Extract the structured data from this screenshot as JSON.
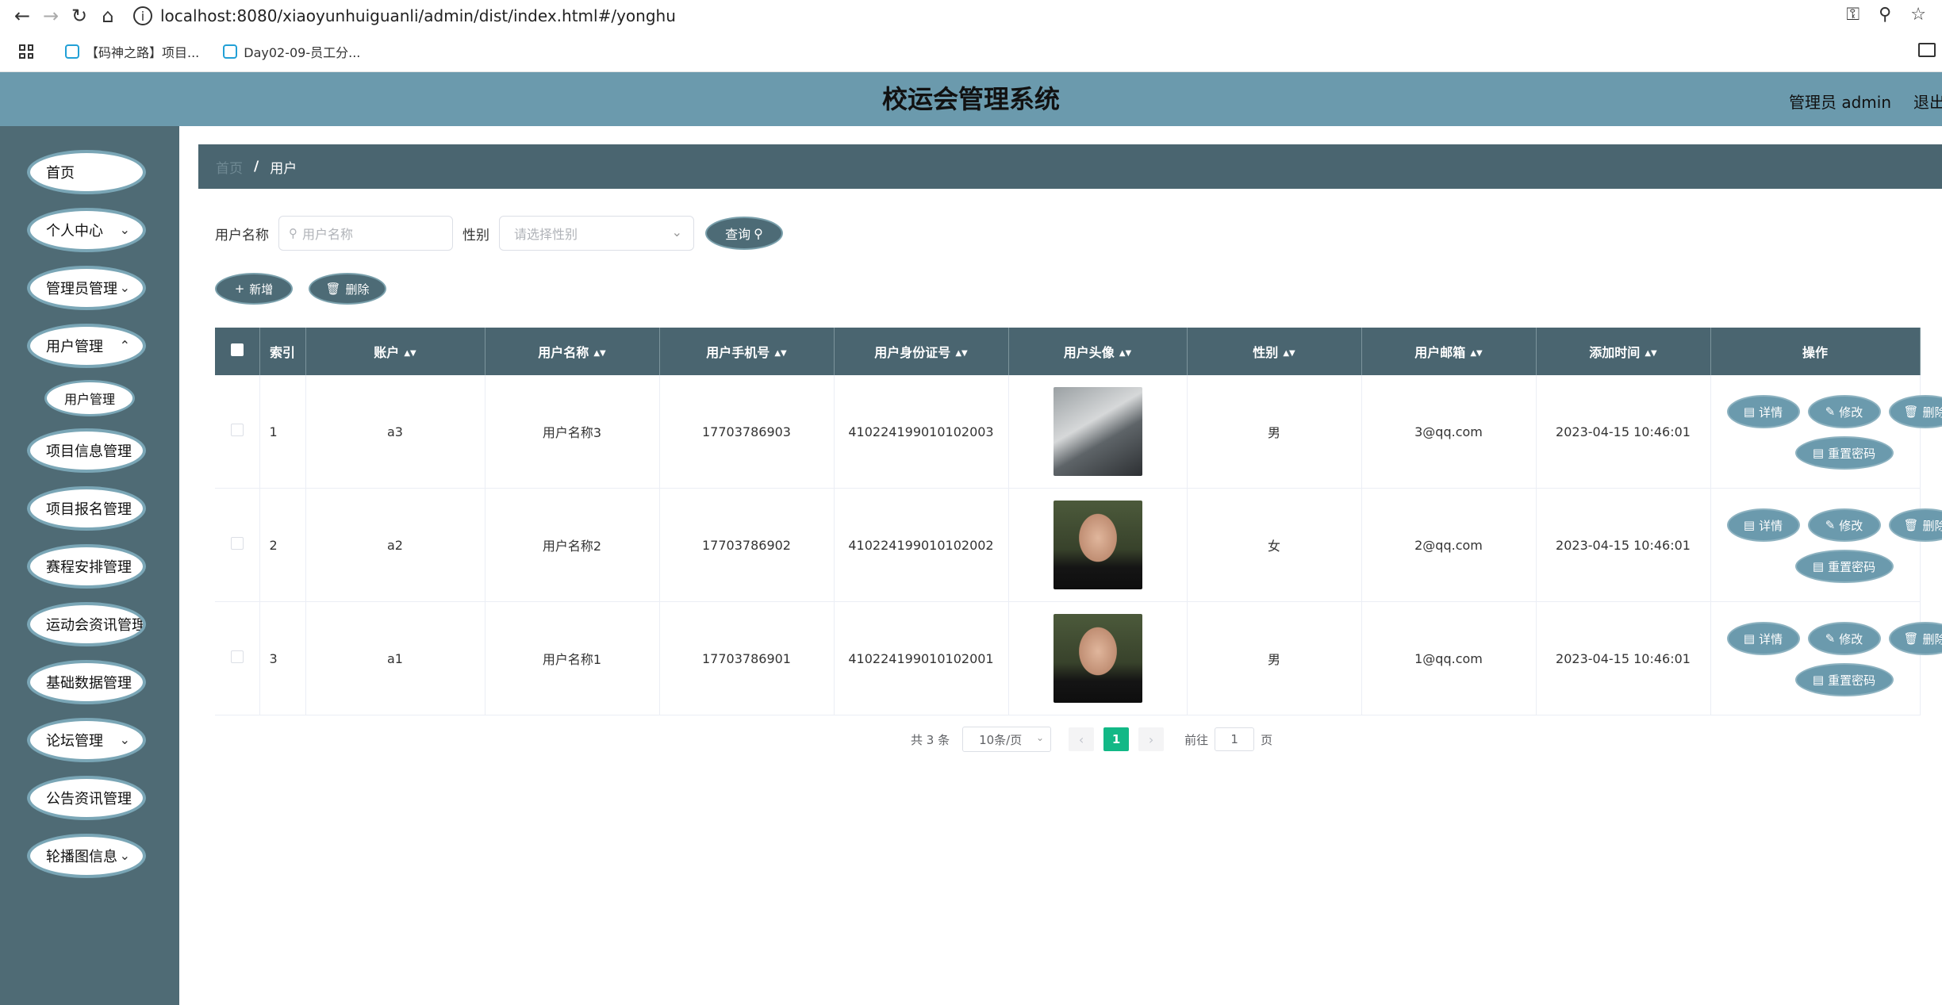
{
  "browser": {
    "url": "localhost:8080/xiaoyunhuiguanli/admin/dist/index.html#/yonghu",
    "bookmarks": [
      "【码神之路】项目...",
      "Day02-09-员工分..."
    ]
  },
  "header": {
    "title": "校运会管理系统",
    "user": "管理员 admin",
    "logout": "退出"
  },
  "sidebar": {
    "items": [
      {
        "label": "首页",
        "has_arrow": false
      },
      {
        "label": "个人中心",
        "has_arrow": true
      },
      {
        "label": "管理员管理",
        "has_arrow": true
      },
      {
        "label": "用户管理",
        "has_arrow": true
      },
      {
        "label": "项目信息管理",
        "has_arrow": true
      },
      {
        "label": "项目报名管理",
        "has_arrow": true
      },
      {
        "label": "赛程安排管理",
        "has_arrow": true
      },
      {
        "label": "运动会资讯管理",
        "has_arrow": true
      },
      {
        "label": "基础数据管理",
        "has_arrow": true
      },
      {
        "label": "论坛管理",
        "has_arrow": true
      },
      {
        "label": "公告资讯管理",
        "has_arrow": true
      },
      {
        "label": "轮播图信息",
        "has_arrow": true
      }
    ],
    "submenu": "用户管理"
  },
  "breadcrumb": {
    "home": "首页",
    "current": "用户"
  },
  "search": {
    "username_label": "用户名称",
    "username_placeholder": "用户名称",
    "gender_label": "性别",
    "gender_placeholder": "请选择性别",
    "query_label": "查询"
  },
  "actions": {
    "add_label": "新增",
    "delete_label": "删除"
  },
  "table": {
    "columns": [
      "索引",
      "账户",
      "用户名称",
      "用户手机号",
      "用户身份证号",
      "用户头像",
      "性别",
      "用户邮箱",
      "添加时间",
      "操作"
    ],
    "rows": [
      {
        "index": "1",
        "account": "a3",
        "name": "用户名称3",
        "phone": "17703786903",
        "idcard": "410224199010102003",
        "avatar": "husky",
        "gender": "男",
        "email": "3@qq.com",
        "time": "2023-04-15 10:46:01"
      },
      {
        "index": "2",
        "account": "a2",
        "name": "用户名称2",
        "phone": "17703786902",
        "idcard": "410224199010102002",
        "avatar": "man",
        "gender": "女",
        "email": "2@qq.com",
        "time": "2023-04-15 10:46:01"
      },
      {
        "index": "3",
        "account": "a1",
        "name": "用户名称1",
        "phone": "17703786901",
        "idcard": "410224199010102001",
        "avatar": "man",
        "gender": "男",
        "email": "1@qq.com",
        "time": "2023-04-15 10:46:01"
      }
    ],
    "op_labels": {
      "detail": "详情",
      "edit": "修改",
      "delete": "删除",
      "reset": "重置密码"
    }
  },
  "pager": {
    "total": "共 3 条",
    "size": "10条/页",
    "current": "1",
    "goto_label": "前往",
    "goto_value": "1",
    "page_unit": "页"
  }
}
